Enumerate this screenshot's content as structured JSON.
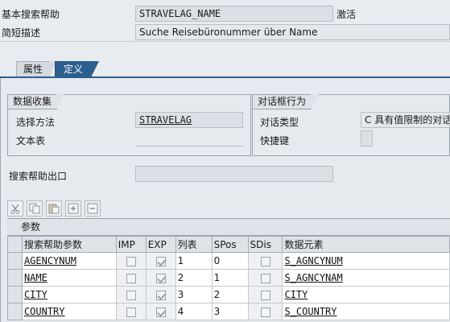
{
  "header": {
    "search_help_label": "基本搜索帮助",
    "search_help_value": "STRAVELAG_NAME",
    "status": "激活",
    "short_desc_label": "简短描述",
    "short_desc_value": "Suche Reisebüronummer über Name"
  },
  "tabs": [
    {
      "label": "属性",
      "active": false
    },
    {
      "label": "定义",
      "active": true
    }
  ],
  "data_collection": {
    "title": "数据收集",
    "selection_method_label": "选择方法",
    "selection_method_value": "STRAVELAG",
    "text_table_label": "文本表"
  },
  "dialog_behavior": {
    "title": "对话框行为",
    "dialog_type_label": "对话类型",
    "dialog_type_value": "C 具有值限制的对话",
    "hotkey_label": "快捷键"
  },
  "exit": {
    "label": "搜索帮助出口",
    "value": ""
  },
  "toolbar": {
    "icons": [
      "cut-icon",
      "copy-icon",
      "paste-icon",
      "insert-row-icon",
      "delete-row-icon"
    ]
  },
  "params_table": {
    "title": "参数",
    "columns": [
      "搜索帮助参数",
      "IMP",
      "EXP",
      "列表",
      "SPos",
      "SDis",
      "数据元素"
    ],
    "rows": [
      {
        "param": "AGENCYNUM",
        "imp": false,
        "exp": true,
        "lpos": "1",
        "spos": "0",
        "sdis": false,
        "element": "S_AGNCYNUM"
      },
      {
        "param": "NAME",
        "imp": false,
        "exp": true,
        "lpos": "2",
        "spos": "1",
        "sdis": false,
        "element": "S_AGNCYNAM"
      },
      {
        "param": "CITY",
        "imp": false,
        "exp": true,
        "lpos": "3",
        "spos": "2",
        "sdis": false,
        "element": "CITY"
      },
      {
        "param": "COUNTRY",
        "imp": false,
        "exp": true,
        "lpos": "4",
        "spos": "3",
        "sdis": false,
        "element": "S_COUNTRY"
      }
    ]
  }
}
